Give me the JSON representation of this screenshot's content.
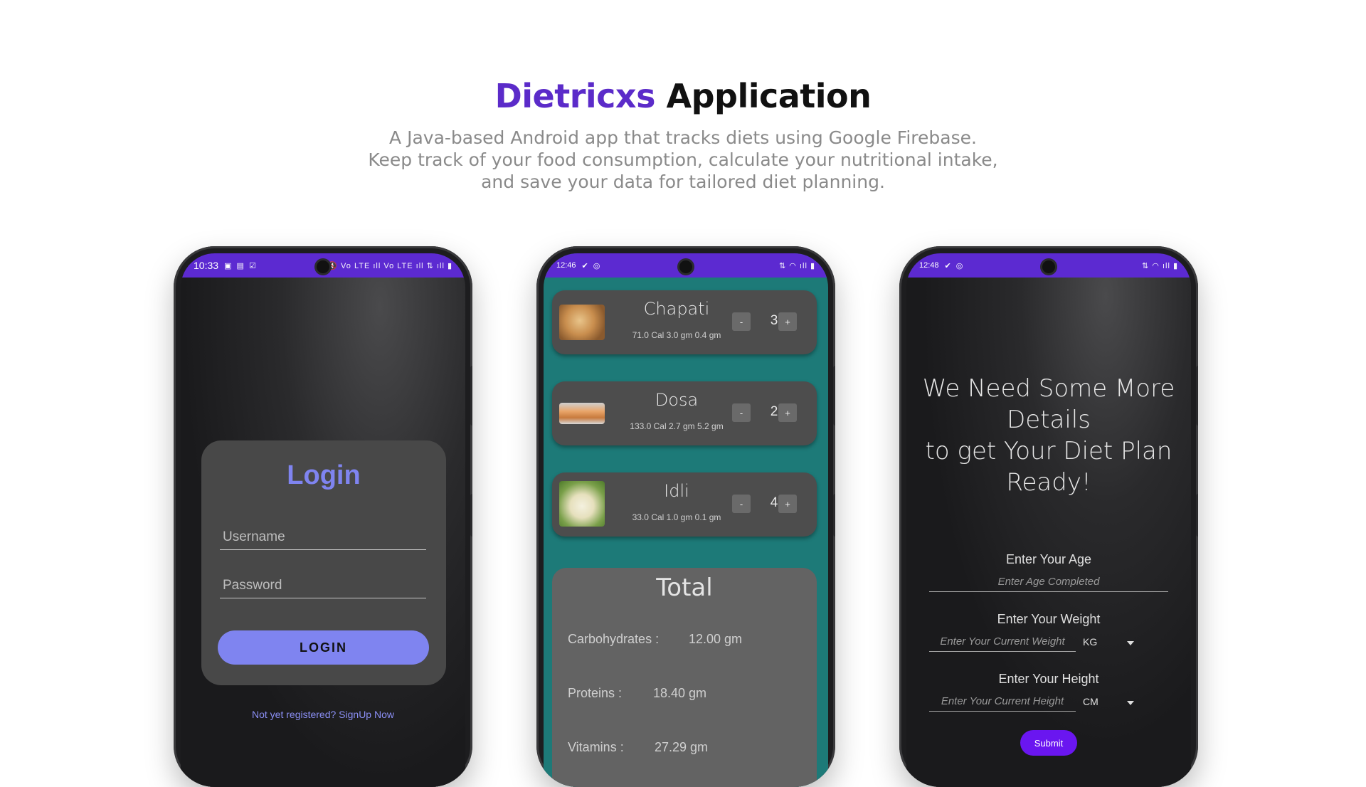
{
  "header": {
    "brand": "Dietricxs",
    "title_rest": "Application",
    "subtitle_lines": [
      "A Java-based Android app that tracks diets using Google Firebase.",
      "Keep track of your food consumption, calculate your nutritional intake,",
      "and save your data for tailored diet planning."
    ]
  },
  "phone1": {
    "status_time": "10:33",
    "status_left_icons": "▣ ▤ ☑",
    "status_right_icons": "🔇 Vo LTE ıll Vo LTE ıll ⇅ ıll ▮",
    "login_title": "Login",
    "username_placeholder": "Username",
    "password_placeholder": "Password",
    "login_button": "LOGIN",
    "signup_text": "Not yet registered? SignUp Now",
    "accent_color": "#7f84f0"
  },
  "phone2": {
    "status_time": "12:46",
    "status_left_icons": "✔ ◎",
    "status_right_icons": "⇅ ◠ ıll ▮",
    "foods": [
      {
        "name": "Chapati",
        "nutrition": "71.0 Cal  3.0 gm  0.4 gm",
        "qty": "3",
        "minus": "-",
        "plus": "+"
      },
      {
        "name": "Dosa",
        "nutrition": "133.0 Cal  2.7 gm  5.2 gm",
        "qty": "2",
        "minus": "-",
        "plus": "+"
      },
      {
        "name": "Idli",
        "nutrition": "33.0 Cal  1.0 gm  0.1 gm",
        "qty": "4",
        "minus": "-",
        "plus": "+"
      }
    ],
    "total": {
      "title": "Total",
      "carbs_label": "Carbohydrates :",
      "carbs_value": "12.00 gm",
      "proteins_label": "Proteins :",
      "proteins_value": "18.40 gm",
      "vitamins_label": "Vitamins :",
      "vitamins_value": "27.29 gm"
    }
  },
  "phone3": {
    "status_time": "12:48",
    "status_left_icons": "✔ ◎",
    "status_right_icons": "⇅ ◠ ıll ▮",
    "headline_line1": "We Need Some More Details",
    "headline_line2": "to get Your Diet Plan Ready!",
    "age_label": "Enter Your Age",
    "age_placeholder": "Enter Age Completed",
    "weight_label": "Enter Your Weight",
    "weight_placeholder": "Enter Your Current Weight",
    "weight_unit": "KG",
    "height_label": "Enter Your Height",
    "height_placeholder": "Enter Your Current Height",
    "height_unit": "CM",
    "submit": "Submit"
  },
  "colors": {
    "brand_purple": "#5b2bc9",
    "status_bar": "#5c2ad1",
    "teal_background": "#1d7a78",
    "submit_purple": "#6a16f0"
  }
}
